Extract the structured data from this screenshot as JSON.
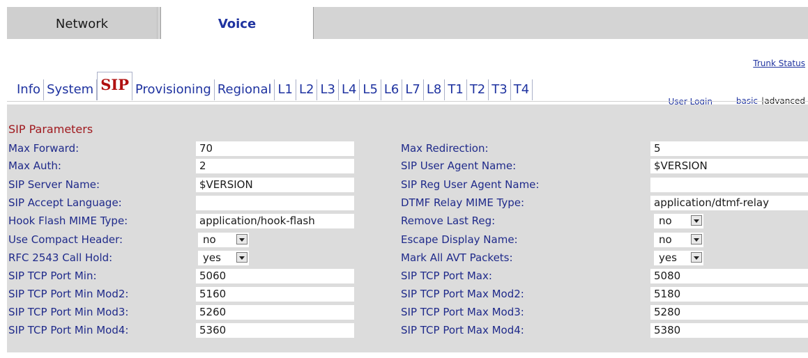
{
  "top_tabs": [
    "Network",
    "Voice"
  ],
  "sub_tabs": [
    "Info",
    "System",
    "SIP",
    "Provisioning",
    "Regional",
    "L1",
    "L2",
    "L3",
    "L4",
    "L5",
    "L6",
    "L7",
    "L8",
    "T1",
    "T2",
    "T3",
    "T4"
  ],
  "active_sub_tab": "SIP",
  "links": {
    "trunk_status": "Trunk Status",
    "user_login": "User Login",
    "basic": "basic",
    "separator": "|",
    "advanced": "advanced"
  },
  "section_title": "SIP Parameters",
  "rows": [
    {
      "left_label": "Max Forward:",
      "left_value": "70",
      "right_label": "Max Redirection:",
      "right_value": "5"
    },
    {
      "left_label": "Max Auth:",
      "left_value": "2",
      "right_label": "SIP User Agent Name:",
      "right_value": "$VERSION"
    },
    {
      "left_label": "SIP Server Name:",
      "left_value": "$VERSION",
      "right_label": "SIP Reg User Agent Name:",
      "right_value": ""
    },
    {
      "left_label": "SIP Accept Language:",
      "left_value": "",
      "right_label": "DTMF Relay MIME Type:",
      "right_value": "application/dtmf-relay"
    },
    {
      "left_label": "Hook Flash MIME Type:",
      "left_value": "application/hook-flash",
      "right_label": "Remove Last Reg:",
      "right_value": "no"
    },
    {
      "left_label": "Use Compact Header:",
      "left_value": "no",
      "right_label": "Escape Display Name:",
      "right_value": "no"
    },
    {
      "left_label": "RFC 2543 Call Hold:",
      "left_value": "yes",
      "right_label": "Mark All AVT Packets:",
      "right_value": "yes"
    },
    {
      "left_label": "SIP TCP Port Min:",
      "left_value": "5060",
      "right_label": "SIP TCP Port Max:",
      "right_value": "5080"
    },
    {
      "left_label": "SIP TCP Port Min Mod2:",
      "left_value": "5160",
      "right_label": "SIP TCP Port Max Mod2:",
      "right_value": "5180"
    },
    {
      "left_label": "SIP TCP Port Min Mod3:",
      "left_value": "5260",
      "right_label": "SIP TCP Port Max Mod3:",
      "right_value": "5280"
    },
    {
      "left_label": "SIP TCP Port Min Mod4:",
      "left_value": "5360",
      "right_label": "SIP TCP Port Max Mod4:",
      "right_value": "5380"
    }
  ],
  "colors": {
    "tab_text": "#1f33a0",
    "active_tab": "#b01010",
    "section_title": "#a0191e",
    "label": "#1f2a8a",
    "panel_bg": "#dcdcdc"
  }
}
